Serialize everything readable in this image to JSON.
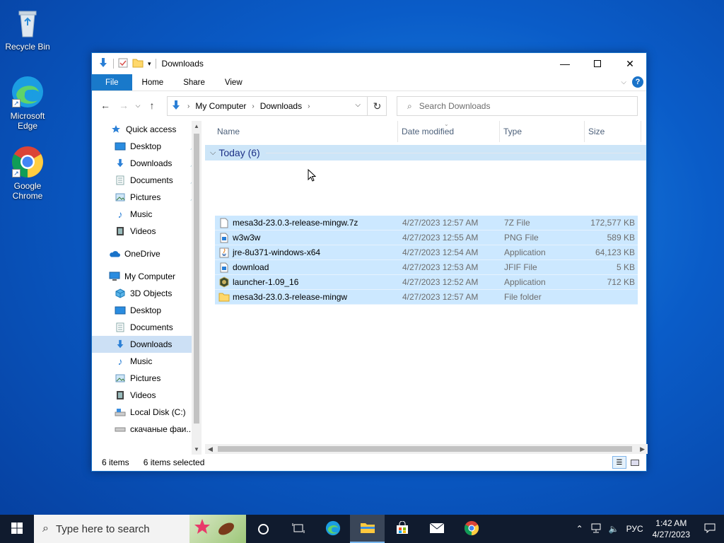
{
  "desktop": {
    "icons": [
      {
        "label": "Recycle Bin"
      },
      {
        "label": "Microsoft Edge"
      },
      {
        "label": "Google Chrome"
      }
    ]
  },
  "window": {
    "title": "Downloads",
    "ribbon_tabs": [
      "File",
      "Home",
      "Share",
      "View"
    ],
    "address": {
      "segments": [
        "My Computer",
        "Downloads"
      ]
    },
    "search": {
      "placeholder": "Search Downloads"
    },
    "nav": {
      "quick_access": "Quick access",
      "quick_items": [
        "Desktop",
        "Downloads",
        "Documents",
        "Pictures",
        "Music",
        "Videos"
      ],
      "onedrive": "OneDrive",
      "my_computer": "My Computer",
      "computer_items": [
        "3D Objects",
        "Desktop",
        "Documents",
        "Downloads",
        "Music",
        "Pictures",
        "Videos",
        "Local Disk (C:)",
        "скачаные фаи..."
      ]
    },
    "columns": {
      "name": "Name",
      "date": "Date modified",
      "type": "Type",
      "size": "Size"
    },
    "group": {
      "label": "Today (6)"
    },
    "files": [
      {
        "name": "mesa3d-23.0.3-release-mingw.7z",
        "date": "4/27/2023 12:57 AM",
        "type": "7Z File",
        "size": "172,577 KB",
        "icon": "archive-icon"
      },
      {
        "name": "w3w3w",
        "date": "4/27/2023 12:55 AM",
        "type": "PNG File",
        "size": "589 KB",
        "icon": "image-icon"
      },
      {
        "name": "jre-8u371-windows-x64",
        "date": "4/27/2023 12:54 AM",
        "type": "Application",
        "size": "64,123 KB",
        "icon": "java-icon"
      },
      {
        "name": "download",
        "date": "4/27/2023 12:53 AM",
        "type": "JFIF File",
        "size": "5 KB",
        "icon": "image-icon"
      },
      {
        "name": "launcher-1.09_16",
        "date": "4/27/2023 12:52 AM",
        "type": "Application",
        "size": "712 KB",
        "icon": "app-icon"
      },
      {
        "name": "mesa3d-23.0.3-release-mingw",
        "date": "4/27/2023 12:57 AM",
        "type": "File folder",
        "size": "",
        "icon": "folder-icon"
      }
    ],
    "status": {
      "count": "6 items",
      "selected": "6 items selected"
    }
  },
  "taskbar": {
    "search_placeholder": "Type here to search",
    "language": "РУС",
    "time": "1:42 AM",
    "date": "4/27/2023"
  }
}
